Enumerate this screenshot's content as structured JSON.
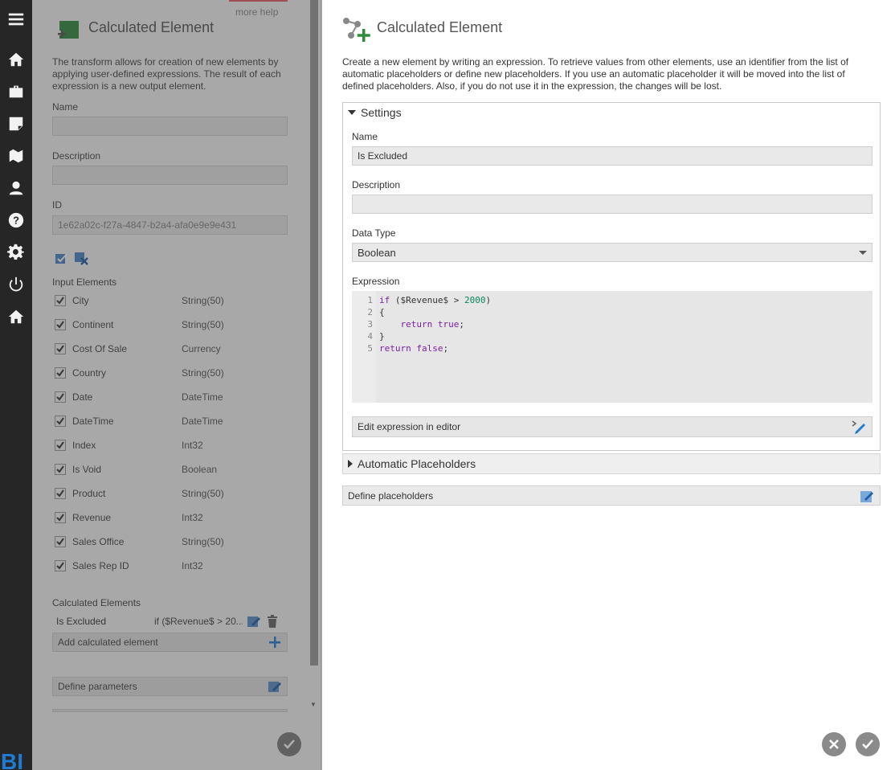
{
  "nav": {
    "items": [
      "menu-icon",
      "home-icon",
      "briefcase-icon",
      "note-icon",
      "map-icon",
      "user-icon",
      "help-icon",
      "gear-icon",
      "power-icon",
      "home-icon"
    ],
    "logo_text": "BI"
  },
  "left_panel": {
    "more_help": "more help",
    "title": "Calculated Element",
    "description": "The transform allows for creation of new elements by applying user-defined expressions. The result of each expression is a new output element.",
    "name_label": "Name",
    "name_value": "",
    "description_label": "Description",
    "description_value": "",
    "id_label": "ID",
    "id_value": "1e62a02c-f27a-4847-b2a4-afa0e9e9e431",
    "input_elements_label": "Input Elements",
    "input_elements": [
      {
        "name": "City",
        "type": "String(50)",
        "checked": true
      },
      {
        "name": "Continent",
        "type": "String(50)",
        "checked": true
      },
      {
        "name": "Cost Of Sale",
        "type": "Currency",
        "checked": true
      },
      {
        "name": "Country",
        "type": "String(50)",
        "checked": true
      },
      {
        "name": "Date",
        "type": "DateTime",
        "checked": true
      },
      {
        "name": "DateTime",
        "type": "DateTime",
        "checked": true
      },
      {
        "name": "Index",
        "type": "Int32",
        "checked": true
      },
      {
        "name": "Is Void",
        "type": "Boolean",
        "checked": true
      },
      {
        "name": "Product",
        "type": "String(50)",
        "checked": true
      },
      {
        "name": "Revenue",
        "type": "Int32",
        "checked": true
      },
      {
        "name": "Sales Office",
        "type": "String(50)",
        "checked": true
      },
      {
        "name": "Sales Rep ID",
        "type": "Int32",
        "checked": true
      }
    ],
    "calculated_elements_label": "Calculated Elements",
    "calculated_elements": [
      {
        "name": "Is Excluded",
        "expression": "if ($Revenue$ > 20..."
      }
    ],
    "add_calculated_label": "Add calculated element",
    "define_parameters_label": "Define parameters"
  },
  "right_panel": {
    "title": "Calculated Element",
    "description": "Create a new element by writing an expression. To retrieve values from other elements, use an identifier from the list of automatic placeholders or define new placeholders. If you use an automatic placeholder it will be moved into the list of defined placeholders. Also, if you do not use it in the expression, the changes will be lost.",
    "settings_label": "Settings",
    "name_label": "Name",
    "name_value": "Is Excluded",
    "description_label": "Description",
    "description_value": "",
    "data_type_label": "Data Type",
    "data_type_value": "Boolean",
    "expression_label": "Expression",
    "expression_line_numbers": [
      "1",
      "2",
      "3",
      "4",
      "5"
    ],
    "edit_expression_label": "Edit expression in editor",
    "automatic_placeholders_label": "Automatic Placeholders",
    "define_placeholders_label": "Define placeholders"
  },
  "colors": {
    "rail": "#262626",
    "accent_green": "#2e8b3e",
    "accent_blue": "#1e7bd1"
  }
}
